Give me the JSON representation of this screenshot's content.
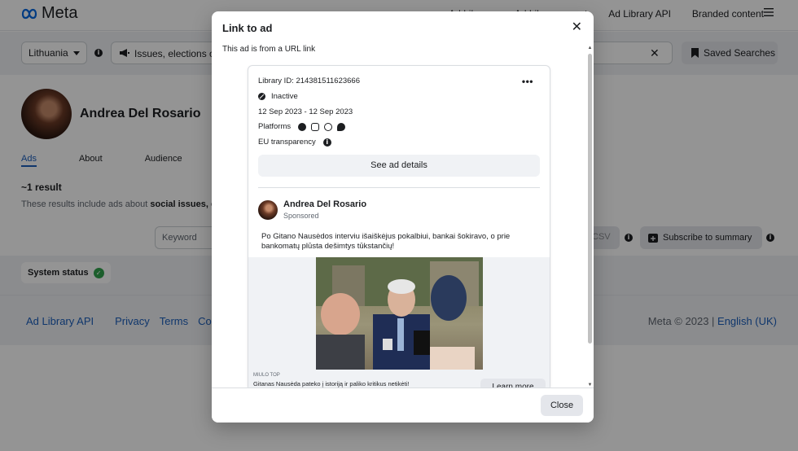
{
  "brand": {
    "name": "Meta"
  },
  "topnav": {
    "links": [
      "Ad Library",
      "Ad Library report",
      "Ad Library API",
      "Branded content"
    ],
    "menu_icon": "hamburger-icon"
  },
  "filters": {
    "country": "Lithuania",
    "ad_type": "Issues, elections or",
    "saved_searches": "Saved Searches"
  },
  "profile": {
    "name": "Andrea Del Rosario",
    "tabs": [
      "Ads",
      "About",
      "Audience"
    ],
    "active_tab": "Ads"
  },
  "results": {
    "count": "~1 result",
    "note_prefix": "These results include ads about ",
    "note_bold": "social issues, el"
  },
  "toolbar": {
    "keyword_placeholder": "Keyword",
    "csv_label": "CSV",
    "subscribe_label": "Subscribe to summary"
  },
  "status": {
    "label": "System status"
  },
  "footer": {
    "links": [
      "Ad Library API",
      "Privacy",
      "Terms",
      "Cool"
    ],
    "copyright": "Meta © 2023 | ",
    "language": "English (UK)"
  },
  "modal": {
    "title": "Link to ad",
    "subtitle": "This ad is from a URL link",
    "close_button": "Close",
    "ad": {
      "library_id": "Library ID: 214381511623666",
      "status": "Inactive",
      "dates": "12 Sep 2023 - 12 Sep 2023",
      "platforms_label": "Platforms",
      "platform_icons": [
        "facebook-icon",
        "instagram-icon",
        "audience-network-icon",
        "messenger-icon"
      ],
      "eu_label": "EU transparency",
      "details_button": "See ad details",
      "author": "Andrea Del Rosario",
      "sponsored": "Sponsored",
      "text": "Po Gitano Nausėdos interviu išaiškėjus pokalbiui, bankai šokiravo, o prie bankomatų plūsta dešimtys tūkstančių!",
      "link_caption": "MIULO TOP",
      "link_title": "Gitanas Nausėda pateko į istoriją ir paliko kritikus netikėti!",
      "cta": "Learn more"
    }
  },
  "colors": {
    "accent": "#1a5dbb",
    "status_ok": "#31a24c",
    "panel_bg": "#f0f2f5"
  }
}
